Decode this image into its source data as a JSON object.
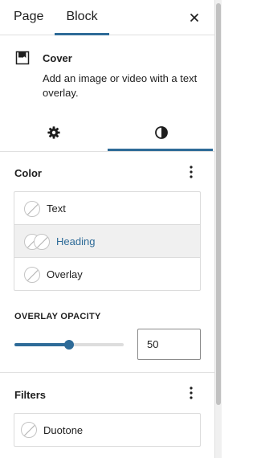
{
  "header": {
    "tabs": [
      "Page",
      "Block"
    ],
    "active_tab": "Block",
    "close_icon": "close-icon"
  },
  "block_card": {
    "icon": "cover-icon",
    "title": "Cover",
    "description": "Add an image or video with a text overlay."
  },
  "inspector_tabs": {
    "items": [
      {
        "icon": "gear-icon",
        "name": "settings"
      },
      {
        "icon": "contrast-icon",
        "name": "styles"
      }
    ],
    "active": "styles"
  },
  "color": {
    "title": "Color",
    "options_icon": "more-vertical-icon",
    "items": [
      {
        "label": "Text",
        "selected": false
      },
      {
        "label": "Heading",
        "selected": true
      },
      {
        "label": "Overlay",
        "selected": false
      }
    ]
  },
  "overlay_opacity": {
    "label": "OVERLAY OPACITY",
    "value": "50",
    "max": 100
  },
  "filters": {
    "title": "Filters",
    "options_icon": "more-vertical-icon",
    "items": [
      {
        "label": "Duotone"
      }
    ]
  },
  "colors": {
    "accent": "#2e6b98",
    "border": "#e0e0e0",
    "selected_row": "#f0f0f0"
  }
}
